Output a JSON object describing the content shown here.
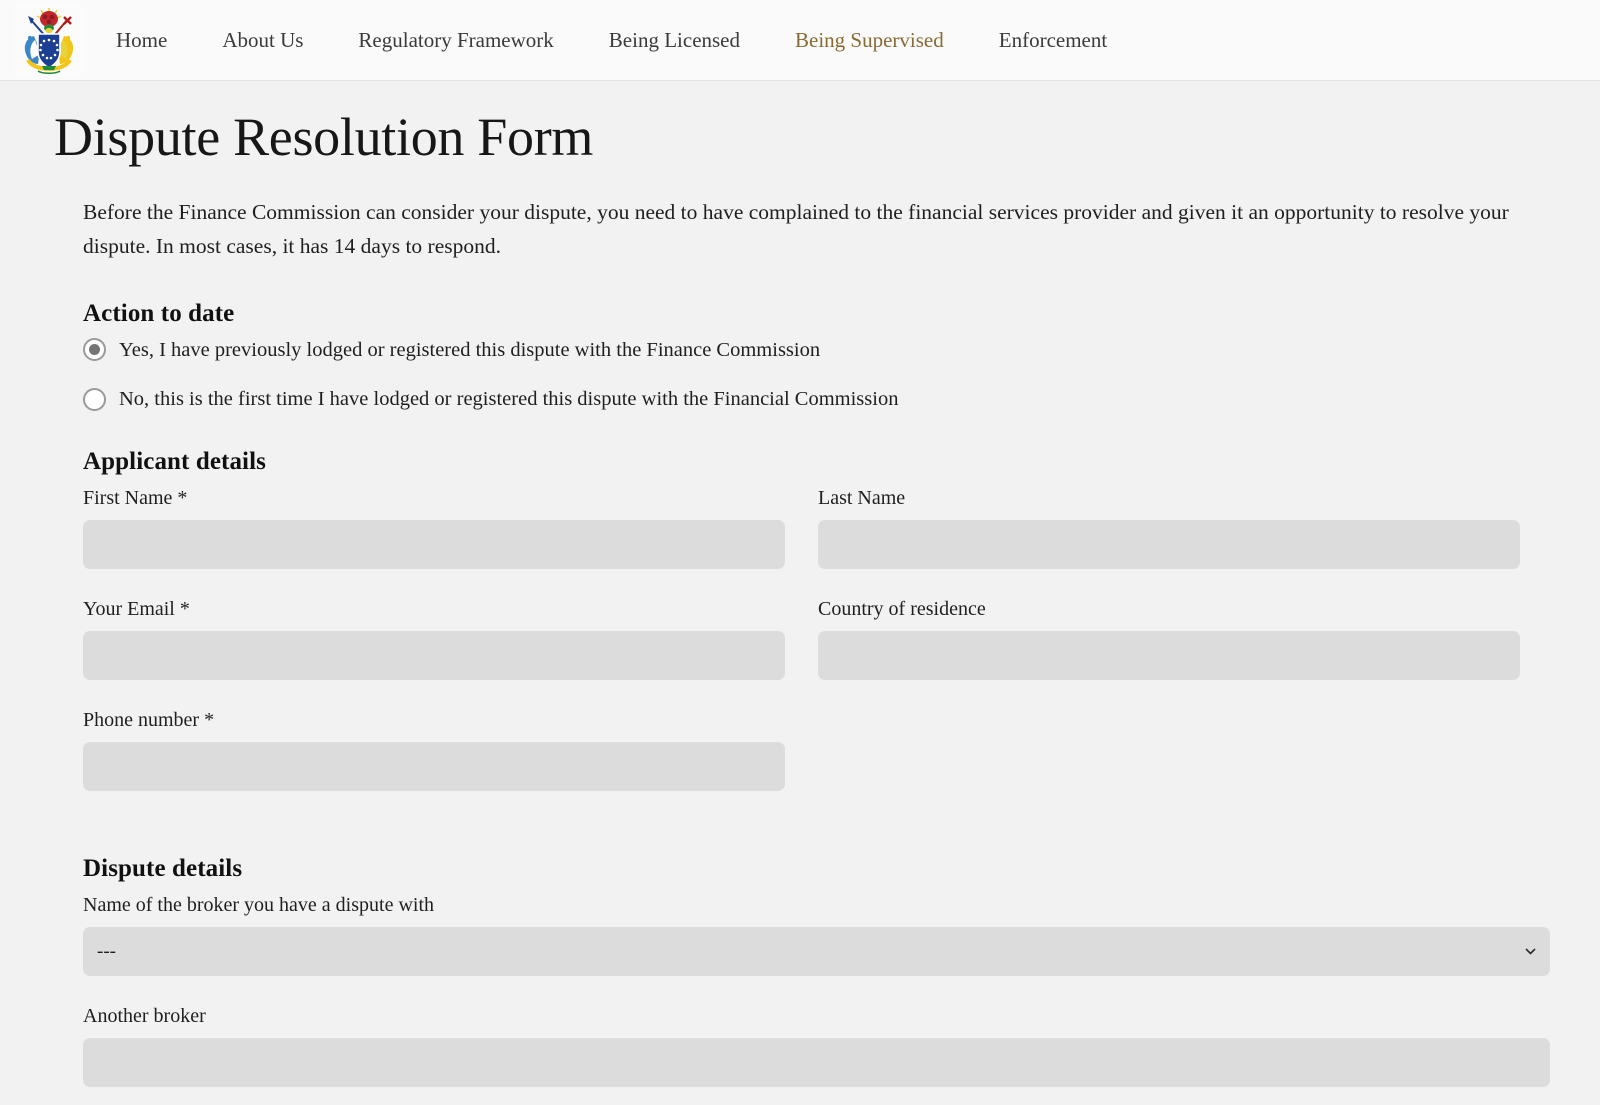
{
  "header": {
    "logo_name": "coat-of-arms-logo",
    "nav": [
      {
        "label": "Home",
        "active": false
      },
      {
        "label": "About Us",
        "active": false
      },
      {
        "label": "Regulatory Framework",
        "active": false
      },
      {
        "label": "Being Licensed",
        "active": false
      },
      {
        "label": "Being Supervised",
        "active": true
      },
      {
        "label": "Enforcement",
        "active": false
      }
    ],
    "active_link_color": "#8a6a33"
  },
  "page": {
    "title": "Dispute Resolution Form",
    "intro": "Before the Finance Commission can consider your dispute, you need to have complained to the financial services provider and given it an opportunity to resolve your dispute. In most cases, it has 14 days to respond."
  },
  "action_to_date": {
    "heading": "Action to date",
    "options": [
      {
        "label": "Yes, I have previously lodged or registered this dispute with the Finance Commission",
        "checked": true
      },
      {
        "label": "No, this is the first time I have lodged or registered this dispute with the Financial Commission",
        "checked": false
      }
    ]
  },
  "applicant_details": {
    "heading": "Applicant details",
    "fields": {
      "first_name": {
        "label": "First Name *",
        "value": "",
        "placeholder": ""
      },
      "last_name": {
        "label": "Last Name",
        "value": "",
        "placeholder": ""
      },
      "email": {
        "label": "Your Email *",
        "value": "",
        "placeholder": ""
      },
      "country": {
        "label": "Country of residence",
        "value": "",
        "placeholder": ""
      },
      "phone": {
        "label": "Phone number *",
        "value": "",
        "placeholder": ""
      }
    }
  },
  "dispute_details": {
    "heading": "Dispute details",
    "broker_select": {
      "label": "Name of the broker you have a dispute with",
      "selected": "---",
      "options": [
        "---"
      ]
    },
    "another_broker": {
      "label": "Another broker",
      "value": "",
      "placeholder": ""
    }
  },
  "colors": {
    "page_background": "#f2f2f2",
    "header_background": "#fafafa",
    "input_background": "#dcdcdc",
    "text": "#1f1f1f",
    "accent": "#8a6a33"
  }
}
